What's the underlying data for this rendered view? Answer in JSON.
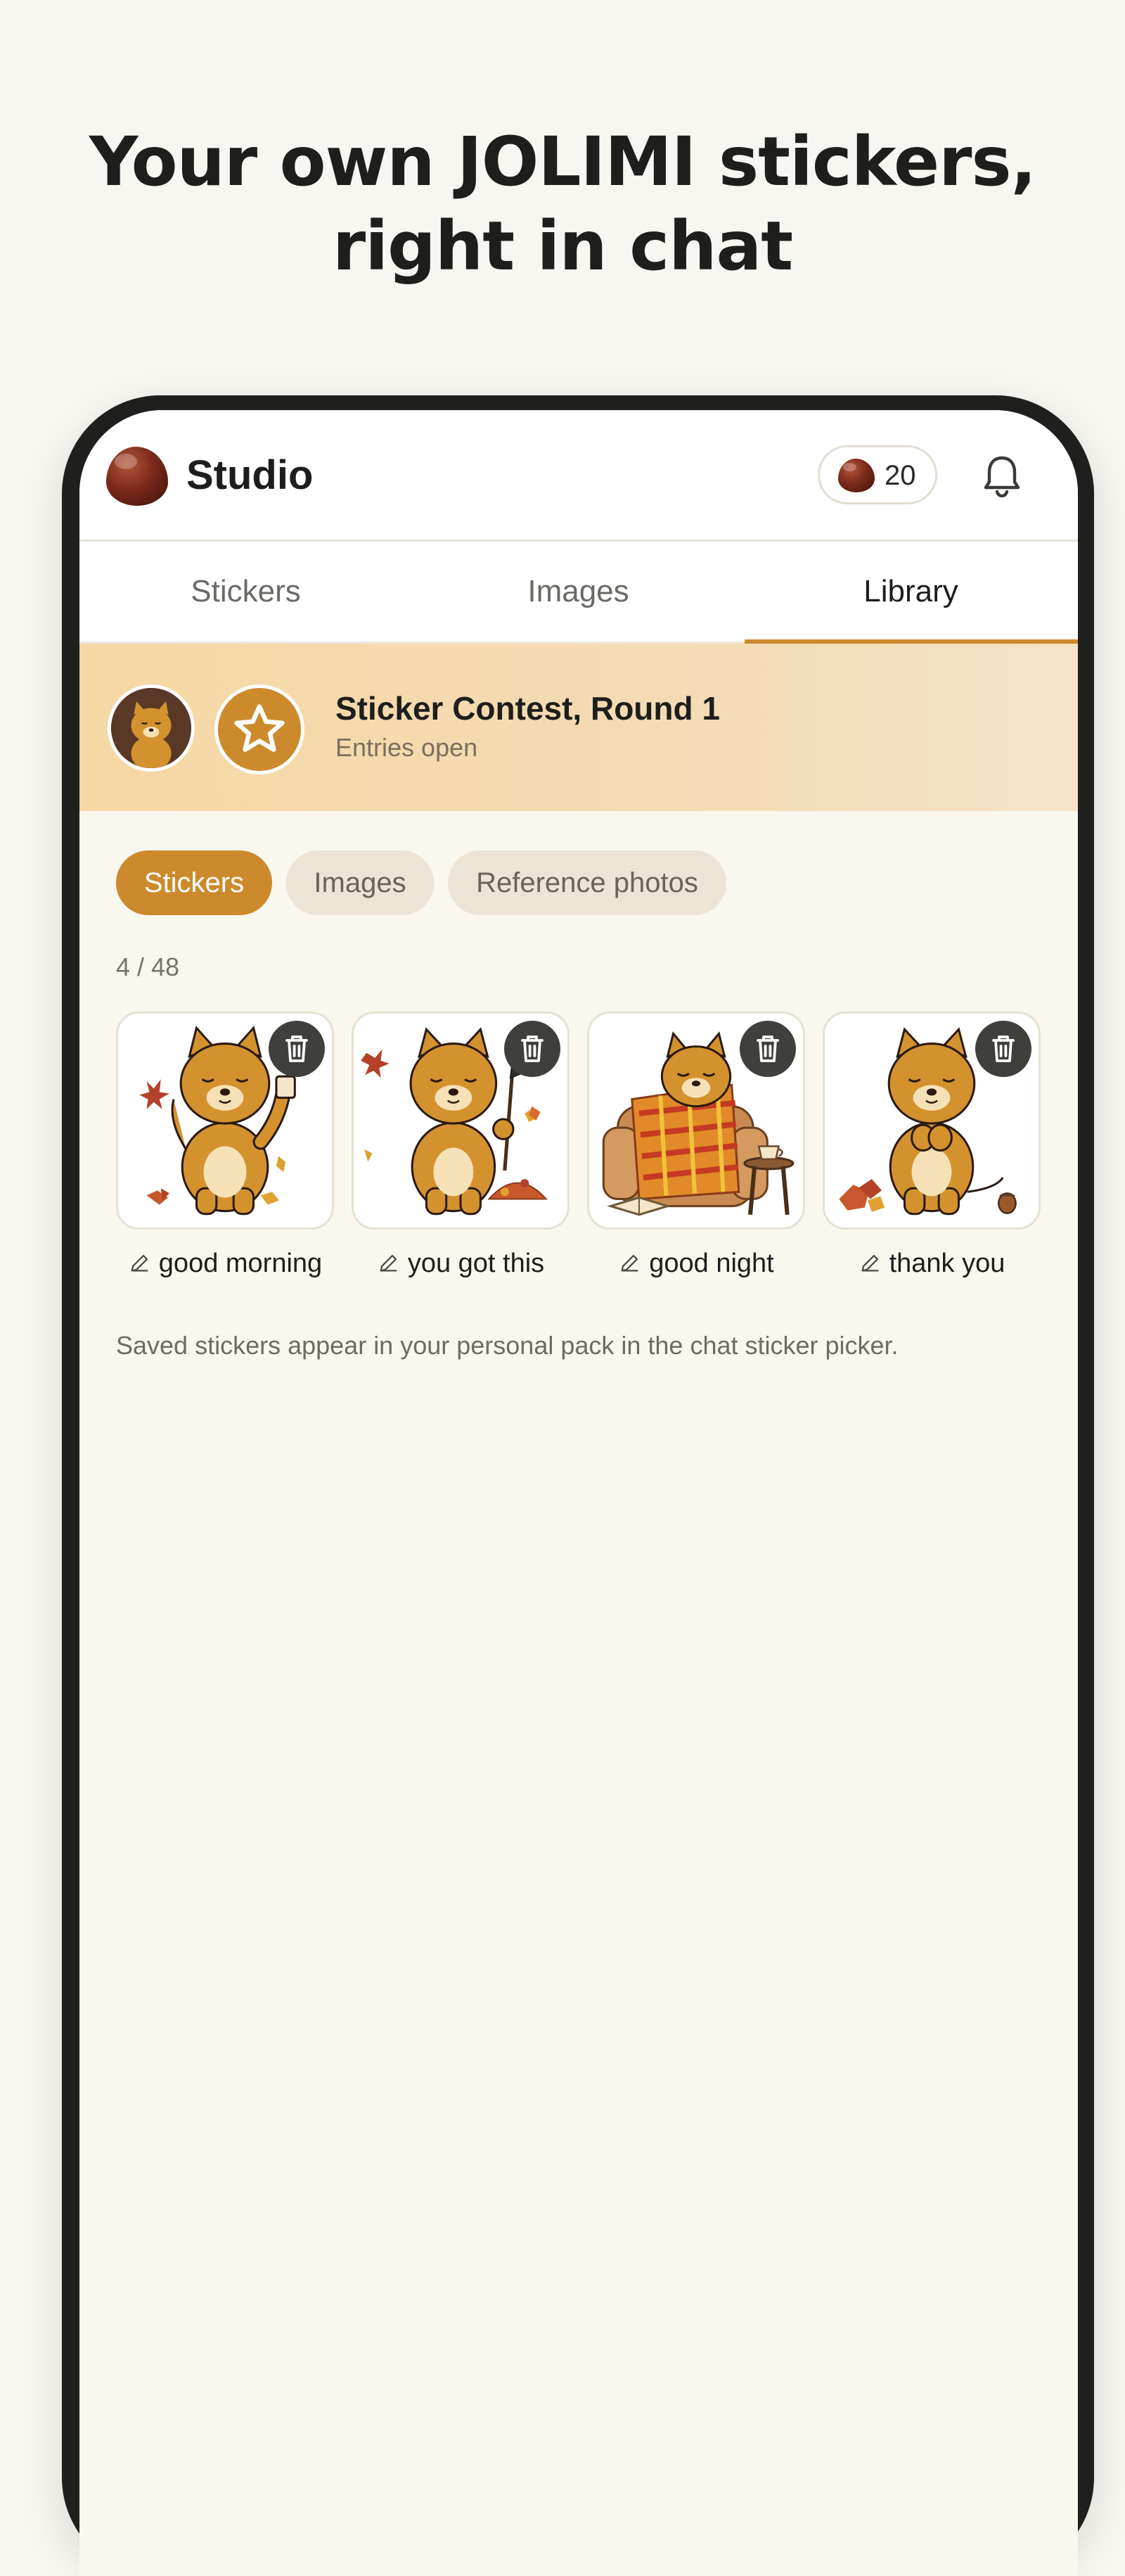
{
  "headline": {
    "line1": "Your own JOLIMI stickers,",
    "line2": "right in chat"
  },
  "appbar": {
    "title": "Studio",
    "logo_icon": "chestnut-icon",
    "coin_count": "20",
    "notification_icon": "bell-icon"
  },
  "tabs": [
    {
      "label": "Stickers",
      "active": false
    },
    {
      "label": "Images",
      "active": false
    },
    {
      "label": "Library",
      "active": true
    }
  ],
  "contest": {
    "title": "Sticker Contest, Round 1",
    "subtitle": "Entries open"
  },
  "filters": [
    {
      "label": "Stickers",
      "active": true
    },
    {
      "label": "Images",
      "active": false
    },
    {
      "label": "Reference photos",
      "active": false
    }
  ],
  "counter": "4 / 48",
  "stickers": [
    {
      "caption": "good morning"
    },
    {
      "caption": "you got this"
    },
    {
      "caption": "good night"
    },
    {
      "caption": "thank you"
    }
  ],
  "note": "Saved stickers appear in your personal pack in the chat sticker picker.",
  "colors": {
    "accent": "#cd8a2c",
    "background": "#faf7ef",
    "banner": "#f5d8a4"
  }
}
